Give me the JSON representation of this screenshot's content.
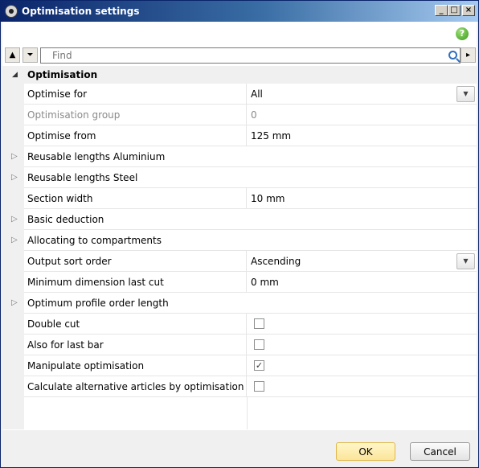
{
  "window": {
    "title": "Optimisation settings"
  },
  "toolbar": {
    "search_placeholder": "Find"
  },
  "group": {
    "title": "Optimisation"
  },
  "rows": [
    {
      "label": "Optimise for",
      "value": "All",
      "kind": "dropdown",
      "disabled": false
    },
    {
      "label": "Optimisation group",
      "value": "0",
      "kind": "text",
      "disabled": true
    },
    {
      "label": "Optimise from",
      "value": "125 mm",
      "kind": "text",
      "disabled": false
    },
    {
      "label": "Reusable lengths Aluminium",
      "kind": "expandable"
    },
    {
      "label": "Reusable lengths Steel",
      "kind": "expandable"
    },
    {
      "label": "Section width",
      "value": "10 mm",
      "kind": "text",
      "disabled": false
    },
    {
      "label": "Basic deduction",
      "kind": "expandable"
    },
    {
      "label": "Allocating to compartments",
      "kind": "expandable"
    },
    {
      "label": "Output sort order",
      "value": "Ascending",
      "kind": "dropdown",
      "disabled": false
    },
    {
      "label": "Minimum dimension last cut",
      "value": "0 mm",
      "kind": "text",
      "disabled": false
    },
    {
      "label": "Optimum profile order length",
      "kind": "expandable"
    },
    {
      "label": "Double cut",
      "checked": false,
      "kind": "checkbox"
    },
    {
      "label": "Also for last bar",
      "checked": false,
      "kind": "checkbox"
    },
    {
      "label": "Manipulate optimisation",
      "checked": true,
      "kind": "checkbox"
    },
    {
      "label": "Calculate alternative articles by optimisation",
      "checked": false,
      "kind": "checkbox"
    }
  ],
  "buttons": {
    "ok": "OK",
    "cancel": "Cancel"
  },
  "colors": {
    "title_gradient_start": "#0a246a",
    "title_gradient_end": "#a6caf0",
    "ok_button": "#fbe59a",
    "gutter": "#f0f0f0"
  },
  "icons": [
    "app-icon",
    "minimize-icon",
    "maximize-icon",
    "close-icon",
    "help-icon",
    "collapse-up-icon",
    "filter-icon",
    "search-icon",
    "scroll-right-icon",
    "expand-triangle-icon",
    "dropdown-arrow-icon",
    "checkmark-icon"
  ]
}
